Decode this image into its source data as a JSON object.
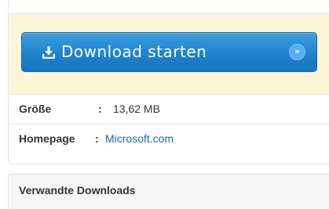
{
  "download": {
    "button_label": "Download starten",
    "icon": "download-icon",
    "arrow_icon": "double-chevron-right-icon",
    "colors": {
      "button": "#1f83cd",
      "arrow_circle": "#52aef0",
      "band": "#fdf5d8"
    }
  },
  "info": {
    "size": {
      "label": "Größe",
      "colon": ":",
      "value": "13,62 MB"
    },
    "homepage": {
      "label": "Homepage",
      "colon": ":",
      "value": "Microsoft.com"
    }
  },
  "related": {
    "title": "Verwandte Downloads"
  }
}
